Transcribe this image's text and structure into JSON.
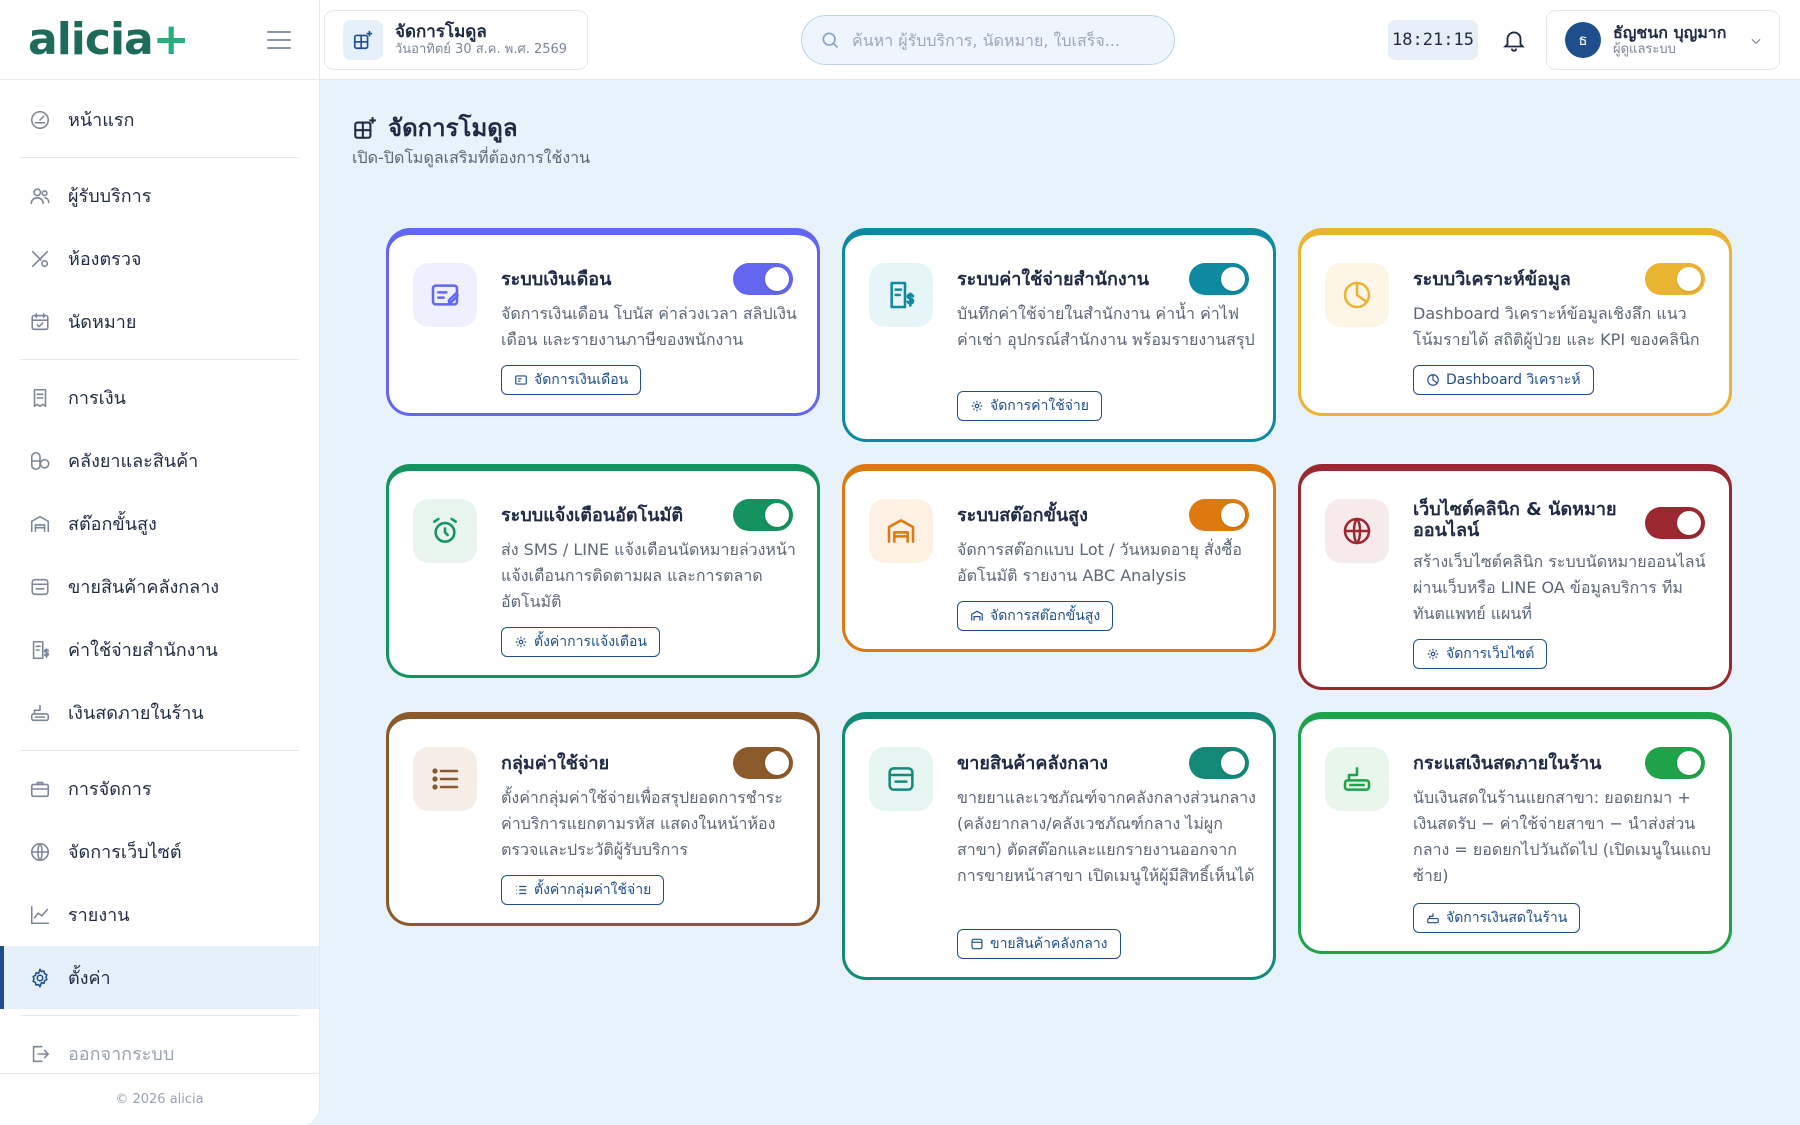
{
  "app": {
    "logo_main": "alicia",
    "logo_plus": "+"
  },
  "sidebar": {
    "items": [
      {
        "label": "หน้าแรก",
        "icon": "dashboard-icon"
      },
      {
        "label": "ผู้รับบริการ",
        "icon": "users-icon"
      },
      {
        "label": "ห้องตรวจ",
        "icon": "stethoscope-icon"
      },
      {
        "label": "นัดหมาย",
        "icon": "calendar-icon"
      },
      {
        "label": "การเงิน",
        "icon": "receipt-icon"
      },
      {
        "label": "คลังยาและสินค้า",
        "icon": "pill-icon"
      },
      {
        "label": "สต๊อกขั้นสูง",
        "icon": "warehouse-icon"
      },
      {
        "label": "ขายสินค้าคลังกลาง",
        "icon": "store-icon"
      },
      {
        "label": "ค่าใช้จ่ายสำนักงาน",
        "icon": "expense-icon"
      },
      {
        "label": "เงินสดภายในร้าน",
        "icon": "cash-register-icon"
      },
      {
        "label": "การจัดการ",
        "icon": "briefcase-icon"
      },
      {
        "label": "จัดการเว็บไซต์",
        "icon": "globe-icon"
      },
      {
        "label": "รายงาน",
        "icon": "chart-line-icon"
      },
      {
        "label": "ตั้งค่า",
        "icon": "gear-icon"
      },
      {
        "label": "ออกจากระบบ",
        "icon": "logout-icon"
      }
    ],
    "active": "ตั้งค่า",
    "footer": "© 2026 alicia"
  },
  "topbar": {
    "page_chip_title": "จัดการโมดูล",
    "page_chip_date": "วันอาทิตย์ 30 ส.ค. พ.ศ. 2569",
    "search_placeholder": "ค้นหา ผู้รับบริการ, นัดหมาย, ใบเสร็จ...",
    "clock": "18:21:15",
    "user_initial": "ธ",
    "user_name": "ธัญชนก บุญมาก",
    "user_role": "ผู้ดูแลระบบ"
  },
  "page": {
    "title": "จัดการโมดูล",
    "subtitle": "เปิด-ปิดโมดูลเสริมที่ต้องการใช้งาน"
  },
  "modules": [
    {
      "title": "ระบบเงินเดือน",
      "desc": "จัดการเงินเดือน โบนัส ค่าล่วงเวลา สลิปเงินเดือน และรายงานภาษีของพนักงาน",
      "button": "จัดการเงินเดือน",
      "icon": "payroll-icon",
      "color": "#6366f1",
      "tint": "#eef0fd",
      "enabled": true
    },
    {
      "title": "ระบบค่าใช้จ่ายสำนักงาน",
      "desc": "บันทึกค่าใช้จ่ายในสำนักงาน ค่าน้ำ ค่าไฟ ค่าเช่า อุปกรณ์สำนักงาน พร้อมรายงานสรุป",
      "button": "จัดการค่าใช้จ่าย",
      "icon": "expense-icon",
      "color": "#0e8aa0",
      "tint": "#e6f5f7",
      "enabled": true
    },
    {
      "title": "ระบบวิเคราะห์ข้อมูล",
      "desc": "Dashboard วิเคราะห์ข้อมูลเชิงลึก แนวโน้มรายได้ สถิติผู้ป่วย และ KPI ของคลินิก",
      "button": "Dashboard วิเคราะห์",
      "icon": "pie-chart-icon",
      "color": "#eab432",
      "tint": "#fdf6e6",
      "enabled": true
    },
    {
      "title": "ระบบแจ้งเตือนอัตโนมัติ",
      "desc": "ส่ง SMS / LINE แจ้งเตือนนัดหมายล่วงหน้า แจ้งเตือนการติดตามผล และการตลาดอัตโนมัติ",
      "button": "ตั้งค่าการแจ้งเตือน",
      "icon": "alarm-icon",
      "color": "#15935f",
      "tint": "#e7f5ee",
      "enabled": true
    },
    {
      "title": "ระบบสต๊อกขั้นสูง",
      "desc": "จัดการสต๊อกแบบ Lot / วันหมดอายุ สั่งซื้ออัตโนมัติ รายงาน ABC Analysis",
      "button": "จัดการสต๊อกขั้นสูง",
      "icon": "warehouse-icon",
      "color": "#dd790f",
      "tint": "#fdf1e4",
      "enabled": true
    },
    {
      "title": "เว็บไซต์คลินิก & นัดหมายออนไลน์",
      "desc": "สร้างเว็บไซต์คลินิก ระบบนัดหมายออนไลน์ผ่านเว็บหรือ LINE OA ข้อมูลบริการ ทีมทันตแพทย์ แผนที่",
      "button": "จัดการเว็บไซต์",
      "icon": "globe-icon",
      "color": "#9b2730",
      "tint": "#f7eaeb",
      "enabled": true
    },
    {
      "title": "กลุ่มค่าใช้จ่าย",
      "desc": "ตั้งค่ากลุ่มค่าใช้จ่ายเพื่อสรุปยอดการชำระค่าบริการแยกตามรหัส แสดงในหน้าห้องตรวจและประวัติผู้รับบริการ",
      "button": "ตั้งค่ากลุ่มค่าใช้จ่าย",
      "icon": "list-icon",
      "color": "#8b5a2b",
      "tint": "#f6eee6",
      "enabled": true
    },
    {
      "title": "ขายสินค้าคลังกลาง",
      "desc": "ขายยาและเวชภัณฑ์จากคลังกลางส่วนกลาง (คลังยากลาง/คลังเวชภัณฑ์กลาง ไม่ผูกสาขา) ตัดสต๊อกและแยกรายงานออกจากการขายหน้าสาขา เปิดเมนูให้ผู้มีสิทธิ์เห็นได้",
      "button": "ขายสินค้าคลังกลาง",
      "icon": "store-icon",
      "color": "#138a78",
      "tint": "#e6f4f2",
      "enabled": true
    },
    {
      "title": "กระแสเงินสดภายในร้าน",
      "desc": "นับเงินสดในร้านแยกสาขา: ยอดยกมา + เงินสดรับ − ค่าใช้จ่ายสาขา − นำส่งส่วนกลาง = ยอดยกไปวันถัดไป (เปิดเมนูในแถบซ้าย)",
      "button": "จัดการเงินสดในร้าน",
      "icon": "cash-register-icon",
      "color": "#1fa34a",
      "tint": "#e8f6ec",
      "enabled": true
    }
  ]
}
